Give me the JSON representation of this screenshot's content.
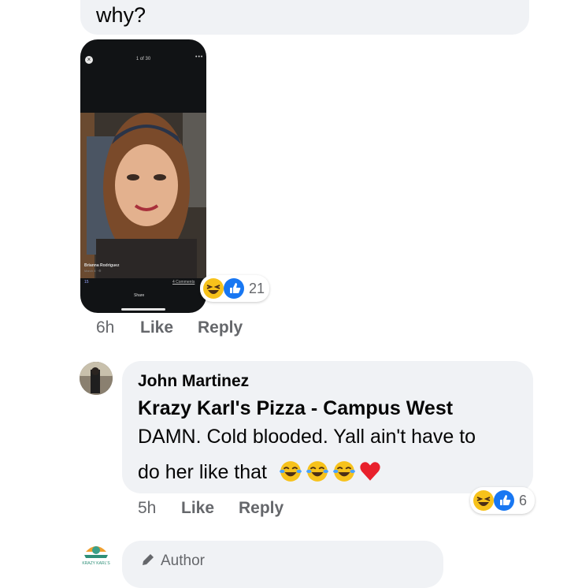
{
  "prev_comment": {
    "text": "why?"
  },
  "screenshot": {
    "counter": "1 of 30",
    "more": "•••",
    "close": "×",
    "name": "Brianna Rodriguez",
    "date": "March 8 · ⚙",
    "reaction_count": "15",
    "comments": "4 Comments",
    "share": "Share"
  },
  "reactions_1": {
    "count": "21"
  },
  "comment_1_meta": {
    "time": "6h",
    "like": "Like",
    "reply": "Reply"
  },
  "comment_2": {
    "author": "John Martinez",
    "tagged": "Krazy Karl's Pizza - Campus West",
    "line1": "DAMN. Cold blooded. Yall ain't have to",
    "line2": "do her like that",
    "reaction_count": "6",
    "time": "5h",
    "like": "Like",
    "reply": "Reply"
  },
  "comment_3": {
    "badge": "Author",
    "avatar_text": "KRAZY KARL'S"
  },
  "colors": {
    "like_blue": "#1877f2",
    "haha_yellow": "#f7c21b",
    "heart_red": "#e8202c",
    "bubble_gray": "#f0f2f5"
  }
}
